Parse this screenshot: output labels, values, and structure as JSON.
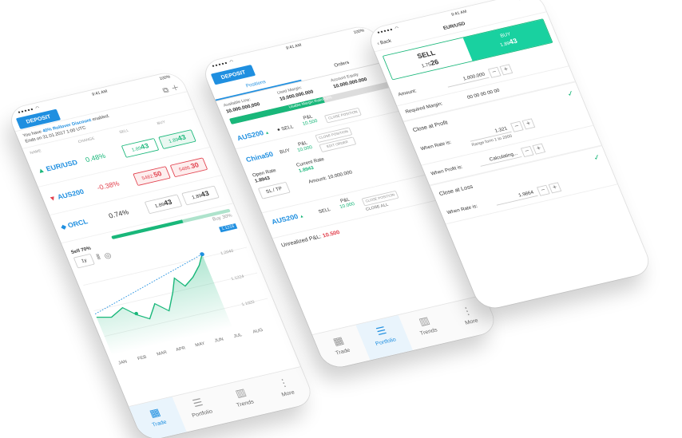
{
  "common": {
    "time": "9:41 AM",
    "battery": "100%",
    "deposit_label": "DEPOSIT"
  },
  "trade": {
    "promo_prefix": "You have ",
    "promo_highlight": "40% Rollover Discount",
    "promo_suffix": " enabled.",
    "promo_end": "Ends on 31.01.2017 1:00 UTC",
    "col_name": "NAME",
    "col_change": "CHANGE",
    "col_sell": "SELL",
    "col_buy": "BUY",
    "rows": [
      {
        "symbol": "EUR/USD",
        "change": "0.48%",
        "sell_pre": "1.89",
        "sell_big": "43",
        "buy_pre": "1.89",
        "buy_big": "43"
      },
      {
        "symbol": "AUS200",
        "change": "-0.38%",
        "sell_pre": "5482.",
        "sell_big": "50",
        "buy_pre": "5486.",
        "buy_big": "30"
      },
      {
        "symbol": "ORCL",
        "change": "0.74%",
        "sell_pre": "1.89",
        "sell_big": "43",
        "buy_pre": "1.89",
        "buy_big": "43"
      }
    ],
    "sentiment_label": "Sell 70%",
    "sentiment_right": "Buy 30%",
    "period": "1y",
    "price_tag": "1.1216",
    "y_labels": [
      "1.2040",
      "1.1224",
      "1.1020"
    ],
    "months": [
      "JAN",
      "FEB",
      "MAR",
      "APR",
      "MAY",
      "JUN",
      "JUL",
      "AUG"
    ],
    "tabs": [
      "Trade",
      "Portfolio",
      "Trends",
      "More"
    ]
  },
  "portfolio": {
    "tab_positions": "Positions",
    "tab_orders": "Orders",
    "available_label": "Available Line:",
    "available_value": "10.000.000,000",
    "used_label": "Used Margin:",
    "used_value": "10.000.000.000",
    "equity_label": "Account Equity",
    "equity_value": "10.000.000.000",
    "usable_label": "Usable Margin Ratio 58%",
    "positions": [
      {
        "symbol": "AUS200",
        "side": "SELL",
        "pnl_label": "P&L",
        "pnl": "10.500",
        "btn": "CLOSE POSITION"
      },
      {
        "symbol": "AUS200",
        "side": "SELL",
        "pnl_label": "P&L",
        "pnl": "10.000",
        "btn": "CLOSE POSITION"
      }
    ],
    "order": {
      "symbol": "China50",
      "side": "BUY",
      "pnl_label": "P&L",
      "pnl": "10.000",
      "btn_close": "CLOSE POSITION",
      "btn_edit": "EDIT ORDER",
      "open_rate_label": "Open Rate",
      "open_rate": "1.8943",
      "current_rate_label": "Current Rate",
      "current_rate": "1.8943",
      "amount_label": "Amount:",
      "amount": "10.000.000",
      "sltp": "SL / TP"
    },
    "close_all": "CLOSE ALL",
    "unrealized_label": "Unrealized P&L:",
    "unrealized_value": "10.500",
    "tabs": [
      "Trade",
      "Portfolio",
      "Trends",
      "More"
    ]
  },
  "order": {
    "back": "Back",
    "title": "EUR/USD",
    "sell_label": "SELL",
    "sell_pre": "1.75",
    "sell_big": "26",
    "buy_label": "BUY",
    "buy_pre": "1.89",
    "buy_big": "43",
    "amount_label": "Amount:",
    "amount": "1.000.000",
    "required_label": "Required Margin:",
    "required_value": "00 00 00 00 00",
    "close_profit": "Close at Profit",
    "when_rate": "When Rate is:",
    "rate_value": "1.321",
    "range_hint": "Range form 1 to 2000",
    "when_profit": "When Profit is:",
    "profit_value": "Calculating...",
    "close_loss": "Close at Loss",
    "when_rate2": "When Rate is:",
    "rate_value2": "1.9864"
  }
}
